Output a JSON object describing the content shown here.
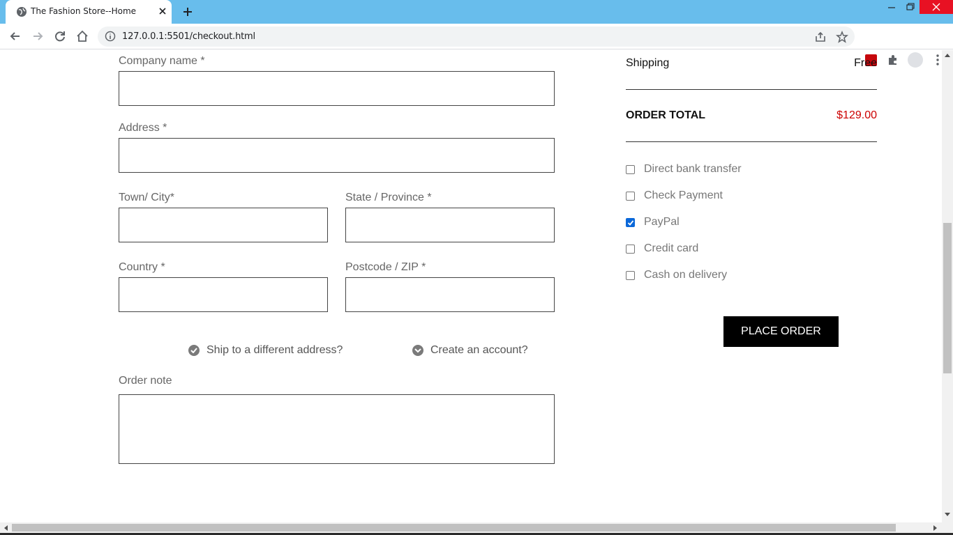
{
  "browser": {
    "tab_title": "The Fashion Store--Home",
    "url": "127.0.0.1:5501/checkout.html"
  },
  "form": {
    "company_label": "Company name *",
    "address_label": "Address *",
    "town_label": "Town/ City*",
    "state_label": "State / Province *",
    "country_label": "Country *",
    "postcode_label": "Postcode / ZIP *",
    "ship_different": "Ship to a different address?",
    "create_account": "Create an account?",
    "order_note_label": "Order note"
  },
  "summary": {
    "shipping_label": "Shipping",
    "shipping_value": "Free",
    "total_label": "ORDER TOTAL",
    "total_value": "$129.00"
  },
  "payment_methods": [
    {
      "label": "Direct bank transfer",
      "checked": false
    },
    {
      "label": "Check Payment",
      "checked": false
    },
    {
      "label": "PayPal",
      "checked": true
    },
    {
      "label": "Credit card",
      "checked": false
    },
    {
      "label": "Cash on delivery",
      "checked": false
    }
  ],
  "place_order_label": "PLACE ORDER",
  "colors": {
    "tabbar": "#68bdec",
    "total_price": "#cc0000",
    "button_bg": "#000000",
    "checkbox_checked": "#0b68d9"
  }
}
